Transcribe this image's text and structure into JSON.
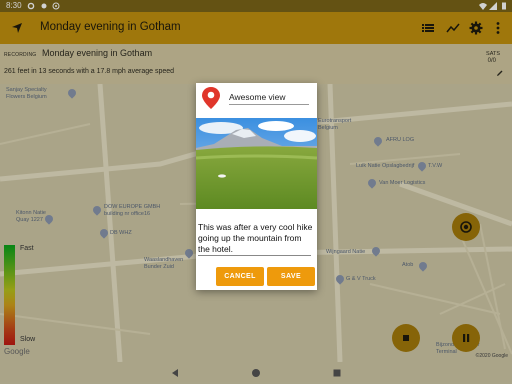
{
  "status_bar": {
    "time": "8:30",
    "icons": [
      "settings-icon",
      "record-dot-icon",
      "hotspot-icon",
      "wifi-icon",
      "signal-icon",
      "battery-icon"
    ]
  },
  "app_bar": {
    "title": "Monday evening in Gotham",
    "icons": [
      "navigation-arrow-icon",
      "list-icon",
      "chart-icon",
      "settings-icon",
      "more-vert-icon"
    ]
  },
  "recording": {
    "label": "RECORDING",
    "name": "Monday evening in Gotham",
    "stats": "261 feet in 13 seconds with a 17.8 mph average speed",
    "sats_label": "SATS",
    "sats_value": "0/0"
  },
  "map": {
    "labels": [
      "Sanjay Specialty\nFlowers Belgium",
      "Kitonn Natie\nQuay 1227",
      "DOW EUROPE GMBH\nbuilding nr office16",
      "DB WHZ",
      "Waaslandhaven\nBunder Zuid",
      "Wijngaard Natie",
      "AFRU LOG",
      "Luik Natie Opslagbedrijf",
      "T.V.W",
      "Van Moer Logistics",
      "Atob",
      "G & V Truck",
      "Eurotransport\nBelgium",
      "Bijzonder Kantoor\nTerminal"
    ],
    "speed_scale": {
      "fast": "Fast",
      "slow": "Slow"
    },
    "google": "Google",
    "copyright": "©2020 Google"
  },
  "dialog": {
    "marker_name": "Awesome view",
    "description": "This was after a very cool hike going up the mountain from the hotel.",
    "cancel_label": "CANCEL",
    "save_label": "SAVE"
  },
  "colors": {
    "app_bar": "#c2920f",
    "status_bar": "#7a6418",
    "accent_button": "#ee9a0c",
    "marker_red": "#e0362b"
  }
}
